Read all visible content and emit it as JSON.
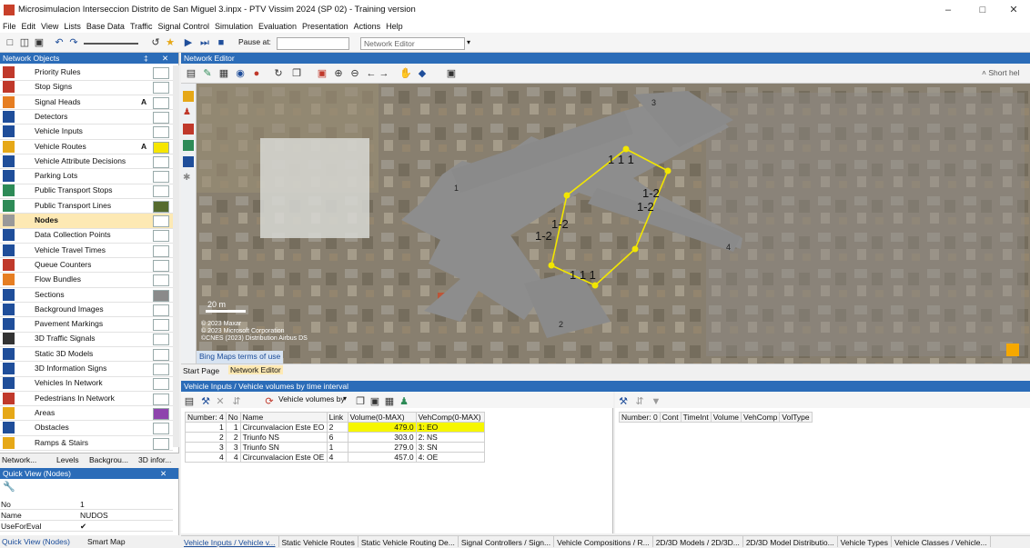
{
  "window": {
    "title": "Microsimulacion Interseccion Distrito de San Miguel 3.inpx - PTV Vissim 2024 (SP 02) - Training version",
    "minimize": "–",
    "maximize": "□",
    "close": "✕"
  },
  "menu": [
    "File",
    "Edit",
    "View",
    "Lists",
    "Base Data",
    "Traffic",
    "Signal Control",
    "Simulation",
    "Evaluation",
    "Presentation",
    "Actions",
    "Help"
  ],
  "toolbar": {
    "pause_label": "Pause at:",
    "editor_dropdown": "Network Editor"
  },
  "network_objects": {
    "header": "Network Objects",
    "items": [
      {
        "label": "Priority Rules",
        "icon": "priority-rules-icon",
        "color": "#c0392b"
      },
      {
        "label": "Stop Signs",
        "icon": "stop-sign-icon",
        "color": "#c0392b"
      },
      {
        "label": "Signal Heads",
        "icon": "signal-head-icon",
        "color": "#e67e22",
        "a": "A"
      },
      {
        "label": "Detectors",
        "icon": "detector-icon",
        "color": "#1f4e9a"
      },
      {
        "label": "Vehicle Inputs",
        "icon": "vehicle-input-icon",
        "color": "#1f4e9a"
      },
      {
        "label": "Vehicle Routes",
        "icon": "vehicle-routes-icon",
        "color": "#e6a817",
        "a": "A",
        "swatch": "#f6e600"
      },
      {
        "label": "Vehicle Attribute Decisions",
        "icon": "attribute-decision-icon",
        "color": "#1f4e9a"
      },
      {
        "label": "Parking Lots",
        "icon": "parking-icon",
        "color": "#1f4e9a"
      },
      {
        "label": "Public Transport Stops",
        "icon": "pt-stop-icon",
        "color": "#2e8b57"
      },
      {
        "label": "Public Transport Lines",
        "icon": "pt-line-icon",
        "color": "#2e8b57",
        "swatch": "#556b2f"
      },
      {
        "label": "Nodes",
        "icon": "nodes-icon",
        "color": "#999999",
        "selected": true
      },
      {
        "label": "Data Collection Points",
        "icon": "data-collection-icon",
        "color": "#1f4e9a"
      },
      {
        "label": "Vehicle Travel Times",
        "icon": "travel-times-icon",
        "color": "#1f4e9a"
      },
      {
        "label": "Queue Counters",
        "icon": "queue-counter-icon",
        "color": "#c0392b"
      },
      {
        "label": "Flow Bundles",
        "icon": "flow-bundles-icon",
        "color": "#e67e22"
      },
      {
        "label": "Sections",
        "icon": "sections-icon",
        "color": "#1f4e9a",
        "swatch": "#8a8a8a"
      },
      {
        "label": "Background Images",
        "icon": "background-image-icon",
        "color": "#1f4e9a"
      },
      {
        "label": "Pavement Markings",
        "icon": "pavement-marking-icon",
        "color": "#1f4e9a"
      },
      {
        "label": "3D Traffic Signals",
        "icon": "traffic-signal-3d-icon",
        "color": "#333333"
      },
      {
        "label": "Static 3D Models",
        "icon": "static-model-icon",
        "color": "#1f4e9a"
      },
      {
        "label": "3D Information Signs",
        "icon": "info-sign-icon",
        "color": "#1f4e9a"
      },
      {
        "label": "Vehicles In Network",
        "icon": "vehicles-network-icon",
        "color": "#1f4e9a"
      },
      {
        "label": "Pedestrians In Network",
        "icon": "pedestrians-network-icon",
        "color": "#c0392b"
      },
      {
        "label": "Areas",
        "icon": "areas-icon",
        "color": "#e6a817",
        "swatch": "#8e44ad"
      },
      {
        "label": "Obstacles",
        "icon": "obstacles-icon",
        "color": "#1f4e9a"
      },
      {
        "label": "Ramps & Stairs",
        "icon": "ramps-stairs-icon",
        "color": "#e6a817"
      }
    ],
    "tabs": [
      "Network...",
      "Levels",
      "Backgrou...",
      "3D infor..."
    ]
  },
  "quick_view": {
    "header": "Quick View (Nodes)",
    "rows": [
      {
        "key": "No",
        "value": "1"
      },
      {
        "key": "Name",
        "value": "NUDOS"
      },
      {
        "key": "UseForEval",
        "value": "✔"
      }
    ],
    "tabs": [
      "Quick View (Nodes)",
      "Smart Map"
    ]
  },
  "network_editor": {
    "header": "Network Editor",
    "short_help": "Short hel",
    "scale_label": "20 m",
    "attribution": [
      "© 2023 Maxar",
      "© 2023 Microsoft Corporation",
      "©CNES (2023) Distribution Airbus DS"
    ],
    "bing_terms": "Bing Maps terms of use",
    "link_labels": [
      "1",
      "2",
      "3",
      "4"
    ],
    "lane_labels": [
      "1 1 1",
      "1-2",
      "1-2",
      "1-2",
      "1-2",
      "1 1 1"
    ],
    "tabs": [
      "Start Page",
      "Network Editor"
    ]
  },
  "vehicle_inputs": {
    "header": "Vehicle Inputs / Vehicle volumes by time interval",
    "toolbar_label": "Vehicle volumes by",
    "columns": [
      "Number: 4",
      "No",
      "Name",
      "Link",
      "Volume(0-MAX)",
      "VehComp(0-MAX)"
    ],
    "rows": [
      {
        "idx": "1",
        "no": "1",
        "name": "Circunvalacion Este EO",
        "link": "2",
        "volume": "479.0",
        "vehcomp": "1: EO",
        "highlight": true
      },
      {
        "idx": "2",
        "no": "2",
        "name": "Triunfo NS",
        "link": "6",
        "volume": "303.0",
        "vehcomp": "2: NS"
      },
      {
        "idx": "3",
        "no": "3",
        "name": "Triunfo SN",
        "link": "1",
        "volume": "279.0",
        "vehcomp": "3: SN"
      },
      {
        "idx": "4",
        "no": "4",
        "name": "Circunvalacion Este OE",
        "link": "4",
        "volume": "457.0",
        "vehcomp": "4: OE"
      }
    ],
    "detail_columns": [
      "Number: 0",
      "Cont",
      "TimeInt",
      "Volume",
      "VehComp",
      "VolType"
    ]
  },
  "bottom_tabs": [
    "Vehicle Inputs / Vehicle v...",
    "Static Vehicle Routes",
    "Static Vehicle Routing De...",
    "Signal Controllers / Sign...",
    "Vehicle Compositions / R...",
    "2D/3D Models / 2D/3D...",
    "2D/3D Model Distributio...",
    "Vehicle Types",
    "Vehicle Classes / Vehicle..."
  ],
  "colors": {
    "panel_blue": "#2b6cb8",
    "selection": "#fde9b4",
    "highlight_yellow": "#f6f600",
    "node_polygon": "#f2e600"
  }
}
